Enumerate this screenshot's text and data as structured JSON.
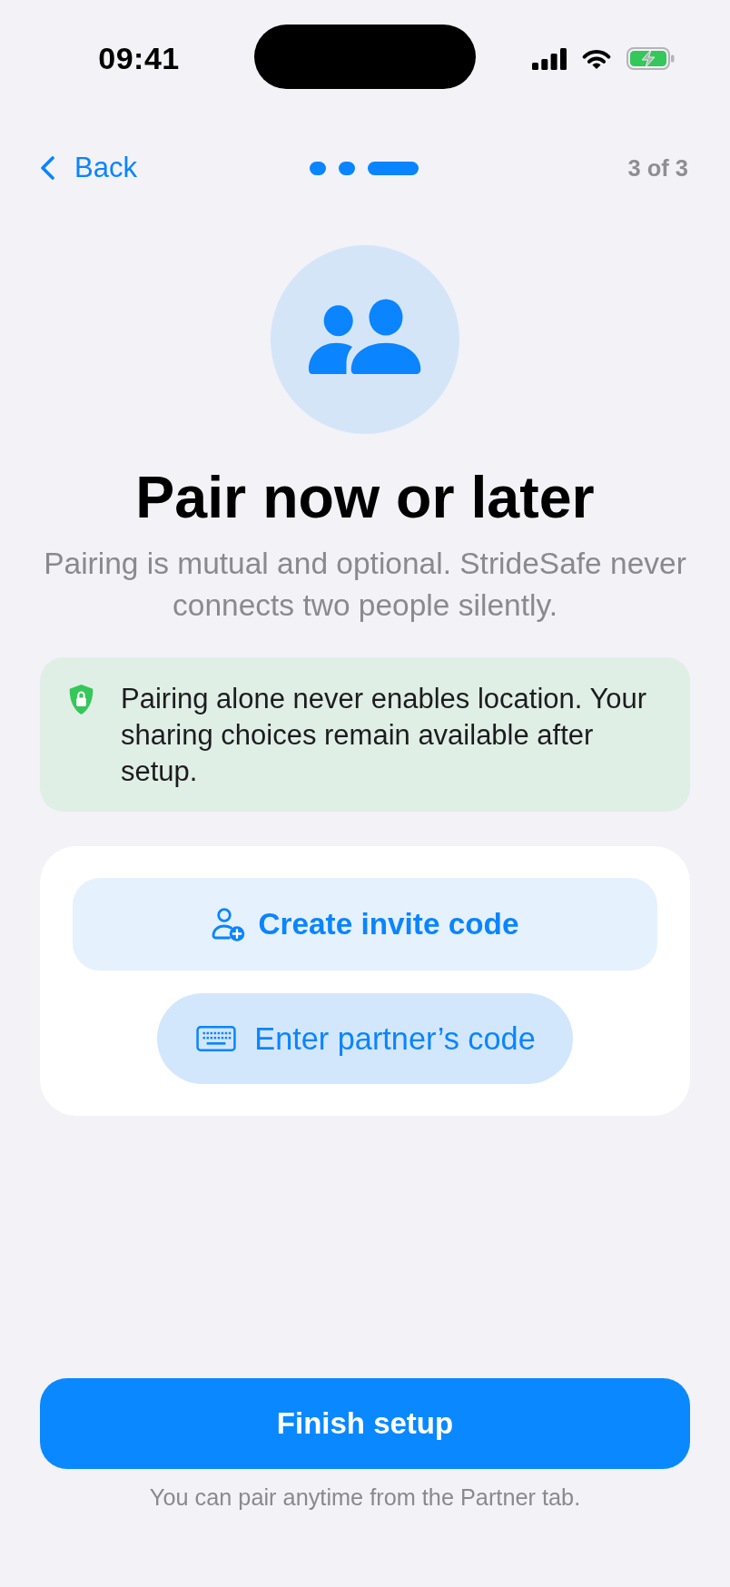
{
  "status_bar": {
    "time": "09:41",
    "charging": true
  },
  "nav": {
    "back_label": "Back",
    "steps": [
      {
        "selected": false
      },
      {
        "selected": false
      },
      {
        "selected": true
      }
    ],
    "step_counter": "3 of 3"
  },
  "hero": {
    "title": "Pair now or later",
    "subtitle": "Pairing is mutual and optional. StrideSafe never connects two people silently."
  },
  "notice": {
    "text": "Pairing alone never enables location. Your sharing choices remain available after setup."
  },
  "actions": [
    {
      "label": "Create invite code",
      "kind": "primary"
    },
    {
      "label": "Enter partner’s code",
      "kind": "secondary"
    }
  ],
  "footer": {
    "button": "Finish setup",
    "note": "You can pair anytime from the Partner tab."
  }
}
